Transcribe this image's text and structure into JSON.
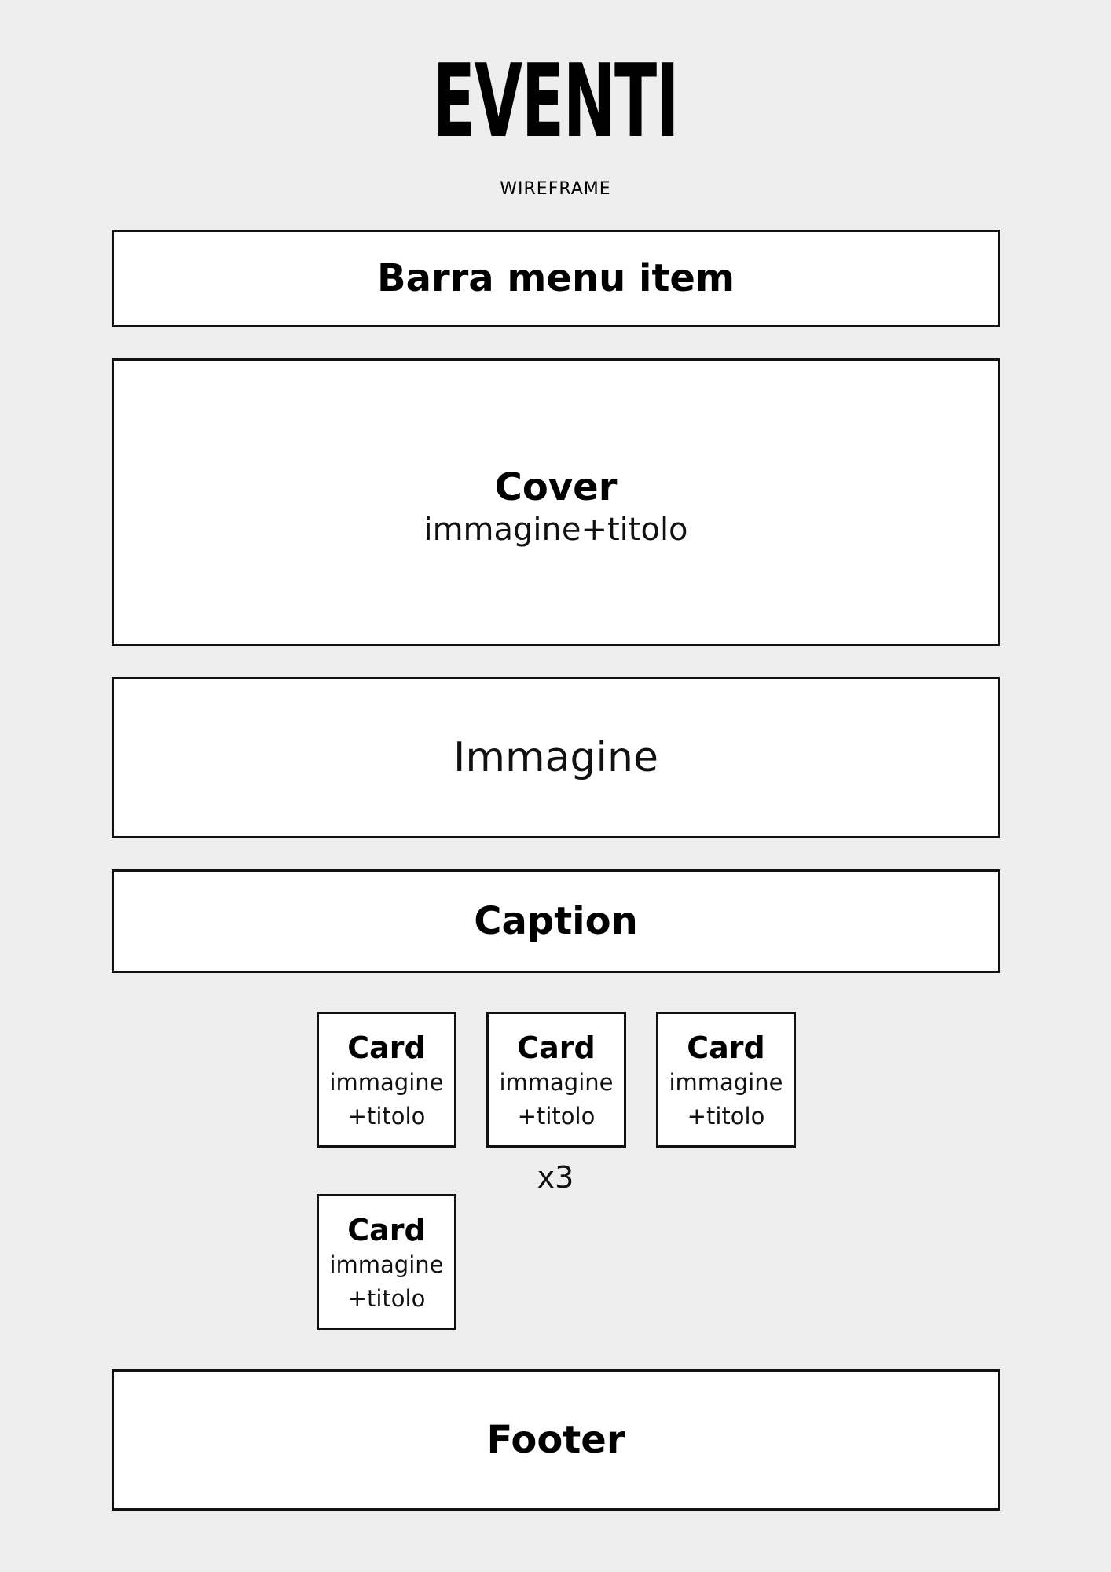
{
  "header": {
    "title": "EVENTI",
    "subtitle": "WIREFRAME"
  },
  "sections": {
    "menu_bar": {
      "label": "Barra menu item"
    },
    "cover": {
      "label": "Cover",
      "sublabel": "immagine+titolo"
    },
    "image": {
      "label": "Immagine"
    },
    "caption": {
      "label": "Caption"
    },
    "footer": {
      "label": "Footer"
    }
  },
  "cards": {
    "items": [
      {
        "title": "Card",
        "line1": "immagine",
        "line2": "+titolo"
      },
      {
        "title": "Card",
        "line1": "immagine",
        "line2": "+titolo"
      },
      {
        "title": "Card",
        "line1": "immagine",
        "line2": "+titolo"
      },
      {
        "title": "Card",
        "line1": "immagine",
        "line2": "+titolo"
      }
    ],
    "multiplier": "x3"
  },
  "colors": {
    "background": "#eeeeee",
    "box_fill": "#ffffff",
    "border": "#111111"
  }
}
